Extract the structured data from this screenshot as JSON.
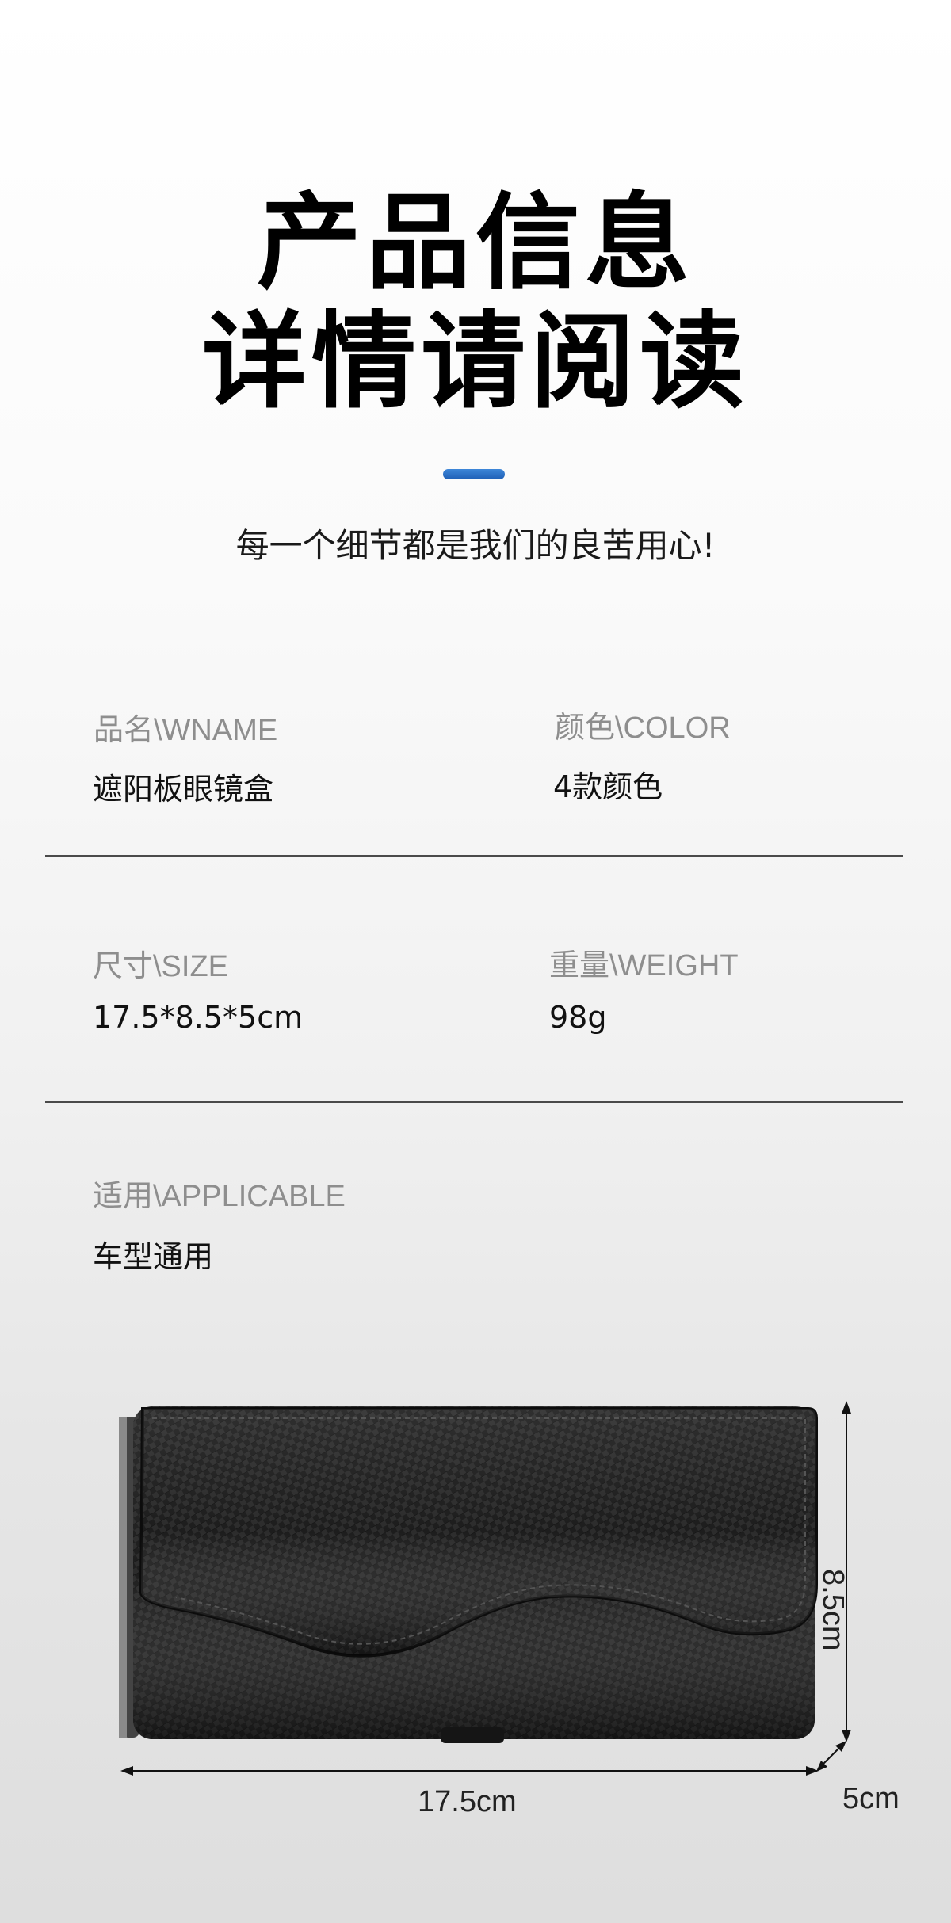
{
  "header": {
    "title_line1": "产品信息",
    "title_line2": "详情请阅读",
    "subtitle": "每一个细节都是我们的良苦用心!",
    "accent_color": "#2a6fc9"
  },
  "specs": {
    "name_label": "品名\\WNAME",
    "name_value": "遮阳板眼镜盒",
    "color_label": "颜色\\COLOR",
    "color_value": "4款颜色",
    "size_label": "尺寸\\SIZE",
    "size_value": "17.5*8.5*5cm",
    "weight_label": "重量\\WEIGHT",
    "weight_value": "98g",
    "applicable_label": "适用\\APPLICABLE",
    "applicable_value": "车型通用"
  },
  "product_image": {
    "dim_width": "17.5cm",
    "dim_height": "8.5cm",
    "dim_depth": "5cm"
  }
}
